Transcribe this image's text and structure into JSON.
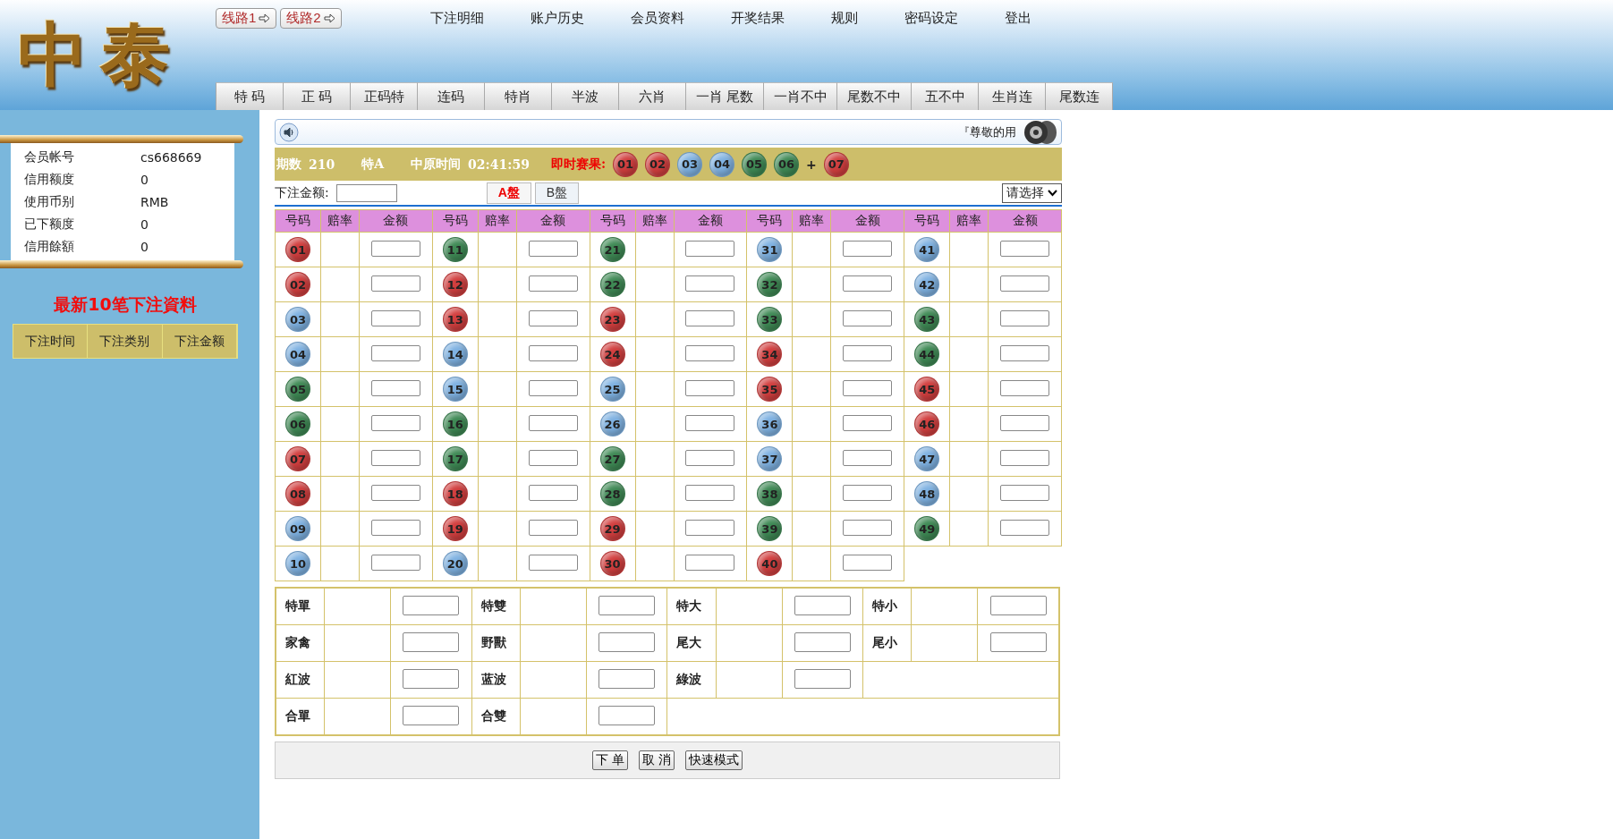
{
  "logo": "中泰",
  "routes": [
    {
      "label": "线路1"
    },
    {
      "label": "线路2"
    }
  ],
  "top_links": [
    "下注明细",
    "账户历史",
    "会员资料",
    "开奖结果",
    "规则",
    "密码设定",
    "登出"
  ],
  "tabs": [
    "特 码",
    "正 码",
    "正码特",
    "连码",
    "特肖",
    "半波",
    "六肖",
    "一肖 尾数",
    "一肖不中",
    "尾数不中",
    "五不中",
    "生肖连",
    "尾数连"
  ],
  "account": {
    "rows": [
      {
        "label": "会员帐号",
        "value": "cs668669"
      },
      {
        "label": "信用额度",
        "value": "0"
      },
      {
        "label": "使用币别",
        "value": "RMB"
      },
      {
        "label": "已下额度",
        "value": "0"
      },
      {
        "label": "信用餘額",
        "value": "0"
      }
    ]
  },
  "recent": {
    "title": "最新10笔下注資料",
    "columns": [
      "下注时间",
      "下注类别",
      "下注金额"
    ]
  },
  "marquee": {
    "text": "『尊敬的用"
  },
  "info": {
    "period_label": "期数",
    "period": "210",
    "type": "特A",
    "time_label": "中原时间",
    "time": "02:41:59",
    "result_label": "即时赛果:",
    "plus": "+",
    "results": [
      {
        "number": "01",
        "color": "#d23f3f"
      },
      {
        "number": "02",
        "color": "#d23f3f"
      },
      {
        "number": "03",
        "color": "#7fb2e2"
      },
      {
        "number": "04",
        "color": "#7fb2e2"
      },
      {
        "number": "05",
        "color": "#3f8a55"
      },
      {
        "number": "06",
        "color": "#3f8a55"
      }
    ],
    "special": {
      "number": "07",
      "color": "#d23f3f"
    }
  },
  "bet_bar": {
    "amount_label": "下注金额:",
    "panels": [
      {
        "label": "A盤",
        "selected": true
      },
      {
        "label": "B盤",
        "selected": false
      }
    ],
    "select": "请选择"
  },
  "grid": {
    "headers": [
      "号码",
      "赔率",
      "金额",
      "号码",
      "赔率",
      "金额",
      "号码",
      "赔率",
      "金额",
      "号码",
      "赔率",
      "金额",
      "号码",
      "赔率",
      "金额"
    ],
    "columns": [
      [
        {
          "number": "01",
          "color": "#d23f3f"
        },
        {
          "number": "02",
          "color": "#d23f3f"
        },
        {
          "number": "03",
          "color": "#7fb2e2"
        },
        {
          "number": "04",
          "color": "#7fb2e2"
        },
        {
          "number": "05",
          "color": "#3f8a55"
        },
        {
          "number": "06",
          "color": "#3f8a55"
        },
        {
          "number": "07",
          "color": "#d23f3f"
        },
        {
          "number": "08",
          "color": "#d23f3f"
        },
        {
          "number": "09",
          "color": "#7fb2e2"
        },
        {
          "number": "10",
          "color": "#7fb2e2"
        }
      ],
      [
        {
          "number": "11",
          "color": "#3f8a55"
        },
        {
          "number": "12",
          "color": "#d23f3f"
        },
        {
          "number": "13",
          "color": "#d23f3f"
        },
        {
          "number": "14",
          "color": "#7fb2e2"
        },
        {
          "number": "15",
          "color": "#7fb2e2"
        },
        {
          "number": "16",
          "color": "#3f8a55"
        },
        {
          "number": "17",
          "color": "#3f8a55"
        },
        {
          "number": "18",
          "color": "#d23f3f"
        },
        {
          "number": "19",
          "color": "#d23f3f"
        },
        {
          "number": "20",
          "color": "#7fb2e2"
        }
      ],
      [
        {
          "number": "21",
          "color": "#3f8a55"
        },
        {
          "number": "22",
          "color": "#3f8a55"
        },
        {
          "number": "23",
          "color": "#d23f3f"
        },
        {
          "number": "24",
          "color": "#d23f3f"
        },
        {
          "number": "25",
          "color": "#7fb2e2"
        },
        {
          "number": "26",
          "color": "#7fb2e2"
        },
        {
          "number": "27",
          "color": "#3f8a55"
        },
        {
          "number": "28",
          "color": "#3f8a55"
        },
        {
          "number": "29",
          "color": "#d23f3f"
        },
        {
          "number": "30",
          "color": "#d23f3f"
        }
      ],
      [
        {
          "number": "31",
          "color": "#7fb2e2"
        },
        {
          "number": "32",
          "color": "#3f8a55"
        },
        {
          "number": "33",
          "color": "#3f8a55"
        },
        {
          "number": "34",
          "color": "#d23f3f"
        },
        {
          "number": "35",
          "color": "#d23f3f"
        },
        {
          "number": "36",
          "color": "#7fb2e2"
        },
        {
          "number": "37",
          "color": "#7fb2e2"
        },
        {
          "number": "38",
          "color": "#3f8a55"
        },
        {
          "number": "39",
          "color": "#3f8a55"
        },
        {
          "number": "40",
          "color": "#d23f3f"
        }
      ],
      [
        {
          "number": "41",
          "color": "#7fb2e2"
        },
        {
          "number": "42",
          "color": "#7fb2e2"
        },
        {
          "number": "43",
          "color": "#3f8a55"
        },
        {
          "number": "44",
          "color": "#3f8a55"
        },
        {
          "number": "45",
          "color": "#d23f3f"
        },
        {
          "number": "46",
          "color": "#d23f3f"
        },
        {
          "number": "47",
          "color": "#7fb2e2"
        },
        {
          "number": "48",
          "color": "#7fb2e2"
        },
        {
          "number": "49",
          "color": "#3f8a55"
        }
      ]
    ]
  },
  "extras": {
    "rows": [
      [
        "特單",
        "特雙",
        "特大",
        "特小"
      ],
      [
        "家禽",
        "野獸",
        "尾大",
        "尾小"
      ],
      [
        "紅波",
        "蓝波",
        "綠波"
      ],
      [
        "合單",
        "合雙"
      ]
    ]
  },
  "buttons": [
    "下 单",
    "取 消",
    "快速模式"
  ]
}
